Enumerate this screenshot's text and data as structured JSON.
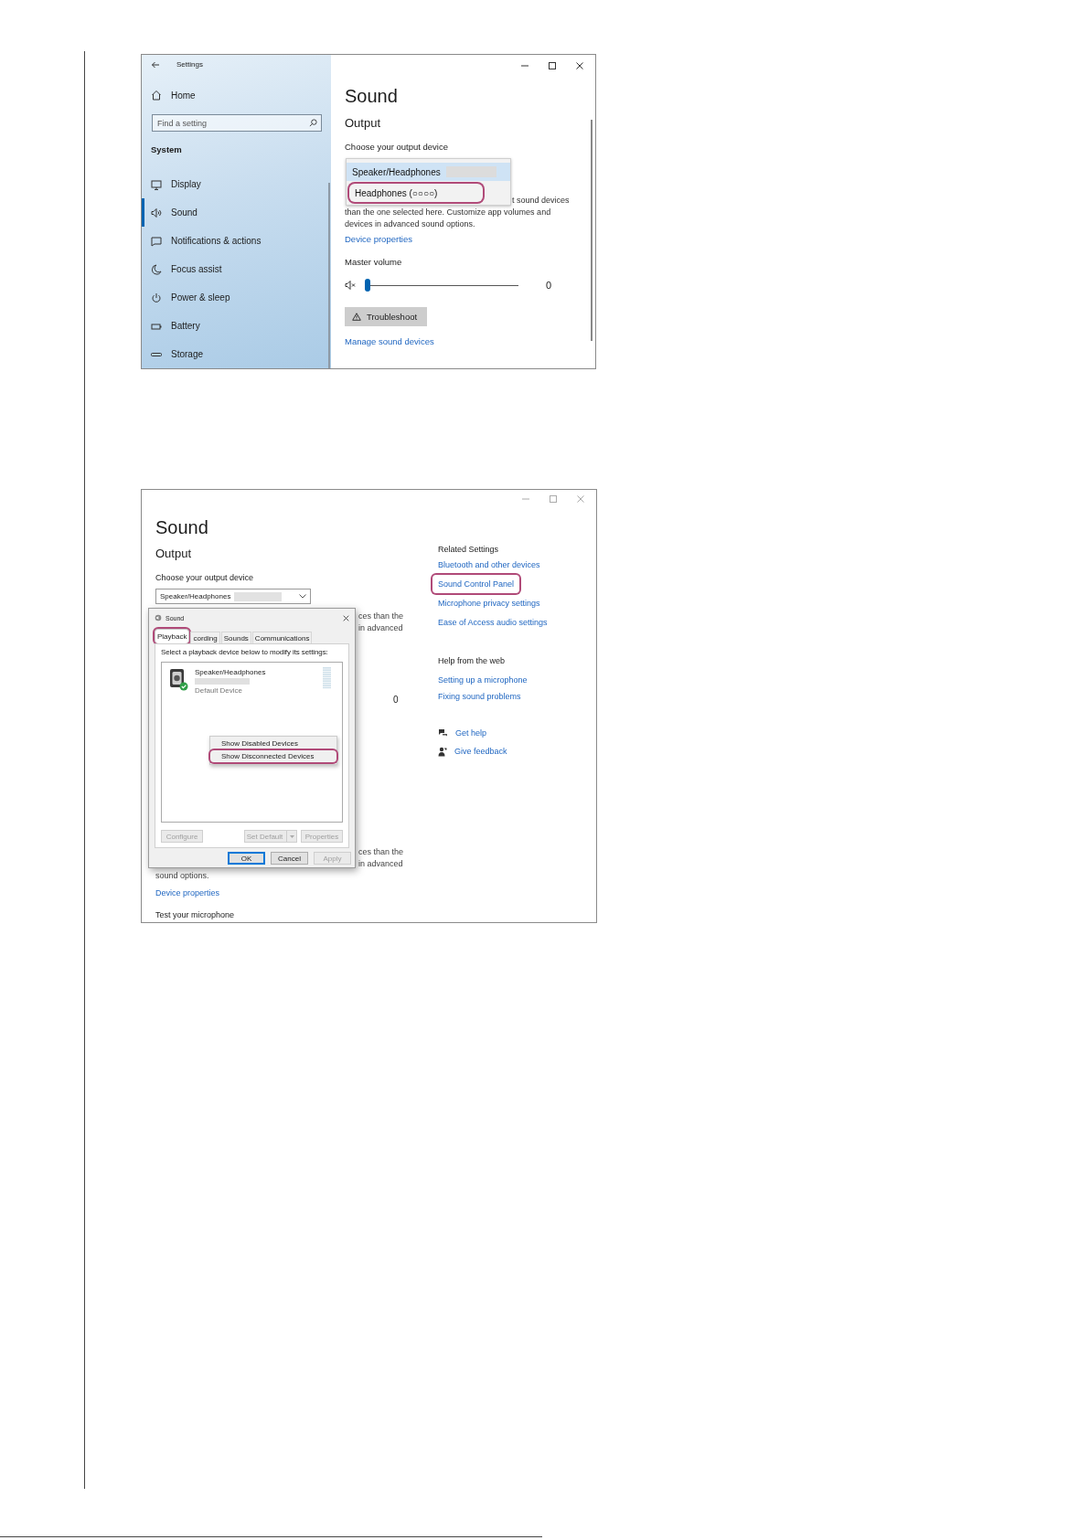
{
  "settings_window": {
    "title": "Settings",
    "home": "Home",
    "search": {
      "placeholder": "Find a setting"
    },
    "section": "System",
    "nav_items": [
      {
        "kind": "display",
        "label": "Display",
        "selected": false
      },
      {
        "kind": "sound",
        "label": "Sound",
        "selected": true
      },
      {
        "kind": "notifications",
        "label": "Notifications & actions",
        "selected": false
      },
      {
        "kind": "focus",
        "label": "Focus assist",
        "selected": false
      },
      {
        "kind": "power",
        "label": "Power & sleep",
        "selected": false
      },
      {
        "kind": "battery",
        "label": "Battery",
        "selected": false
      },
      {
        "kind": "storage",
        "label": "Storage",
        "selected": false
      }
    ],
    "page": {
      "title": "Sound",
      "section": "Output",
      "device_label": "Choose your output device",
      "device_options": [
        {
          "label": "Speaker/Headphones",
          "selected": true,
          "highlighted": false
        },
        {
          "label": "Headphones (○○○○)",
          "selected": false,
          "highlighted": true
        }
      ],
      "description": [
        "t sound devices",
        "than the one selected here. Customize app volumes and",
        "devices in advanced sound options."
      ],
      "device_properties": "Device properties",
      "volume": {
        "label": "Master volume",
        "muted": true,
        "level": 0,
        "reading": "0"
      },
      "troubleshoot": "Troubleshoot",
      "manage": "Manage sound devices"
    }
  },
  "sound_window": {
    "title": "Sound",
    "section": "Output",
    "device_label": "Choose your output device",
    "device_value": "Speaker/Headphones",
    "fragments_upper": [
      "ces than the",
      "in advanced"
    ],
    "volume_reading": "0",
    "fragments_lower": [
      "ces than the",
      "in advanced"
    ],
    "description_end": "sound options.",
    "device_properties": "Device properties",
    "test_microphone": "Test your microphone",
    "related": {
      "heading": "Related Settings",
      "links": [
        {
          "label": "Bluetooth and other devices",
          "highlighted": false
        },
        {
          "label": "Sound Control Panel",
          "highlighted": true
        },
        {
          "label": "Microphone privacy settings",
          "highlighted": false
        },
        {
          "label": "Ease of Access audio settings",
          "highlighted": false
        }
      ]
    },
    "help": {
      "heading": "Help from the web",
      "links": [
        "Setting up a microphone",
        "Fixing sound problems"
      ]
    },
    "actions": [
      {
        "kind": "help",
        "label": "Get help"
      },
      {
        "kind": "feedback",
        "label": "Give feedback"
      }
    ],
    "dialog": {
      "title": "Sound",
      "tabs": [
        {
          "label": "Playback",
          "selected": true,
          "highlighted": true
        },
        {
          "label": "cording",
          "selected": false,
          "highlighted": false
        },
        {
          "label": "Sounds",
          "selected": false,
          "highlighted": false
        },
        {
          "label": "Communications",
          "selected": false,
          "highlighted": false
        }
      ],
      "instruction": "Select a playback device below to modify its settings:",
      "devices": [
        {
          "name": "Speaker/Headphones",
          "status": "Default Device",
          "default": true
        }
      ],
      "context_menu": [
        {
          "label": "Show Disabled Devices",
          "highlighted": false
        },
        {
          "label": "Show Disconnected Devices",
          "highlighted": true
        }
      ],
      "buttons": [
        {
          "label": "Configure",
          "kind": "plain",
          "disabled": true
        },
        {
          "label": "Set Default",
          "kind": "split",
          "disabled": true
        },
        {
          "label": "Properties",
          "kind": "plain",
          "disabled": true
        }
      ],
      "footer_buttons": [
        {
          "label": "OK",
          "disabled": false,
          "default": true
        },
        {
          "label": "Cancel",
          "disabled": false,
          "default": false
        },
        {
          "label": "Apply",
          "disabled": true,
          "default": false
        }
      ]
    }
  }
}
